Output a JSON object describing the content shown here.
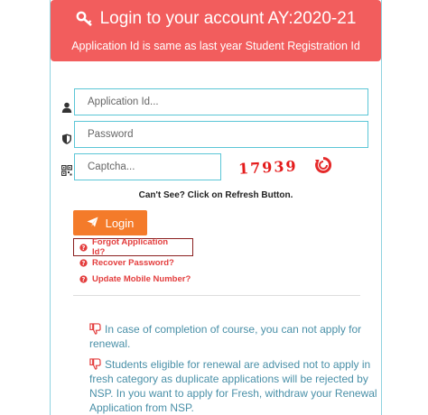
{
  "header": {
    "title": "Login to your account AY:2020-21",
    "subtitle": "Application Id is same as last year Student Registration Id",
    "icon": "key-icon"
  },
  "form": {
    "application_id": {
      "placeholder": "Application Id...",
      "value": "",
      "icon": "user-icon"
    },
    "password": {
      "placeholder": "Password",
      "value": "",
      "icon": "shield-icon"
    },
    "captcha": {
      "placeholder": "Captcha...",
      "value": "",
      "icon": "qrcode-icon"
    },
    "captcha_image_text": "17939",
    "refresh_icon": "refresh-icon",
    "cant_see": "Can't See? Click on Refresh Button.",
    "login_label": "Login",
    "login_icon": "paper-plane-icon"
  },
  "links": [
    {
      "label": "Forgot Application Id?",
      "icon": "question-circle-icon"
    },
    {
      "label": "Recover Password?",
      "icon": "question-circle-icon"
    },
    {
      "label": "Update Mobile Number?",
      "icon": "question-circle-icon"
    }
  ],
  "notices": [
    {
      "text": "In case of completion of course, you can not apply for renewal.",
      "icon": "thumbs-down-icon"
    },
    {
      "text": "Students eligible for renewal are advised not to apply in fresh category as duplicate applications will be rejected by NSP. In you want to apply for Fresh, withdraw your Renewal Application from NSP.",
      "icon": "thumbs-down-icon"
    }
  ],
  "colors": {
    "header_bg": "#f25d5d",
    "input_border": "#5bc6d6",
    "login_button": "#f47b2a",
    "link": "#e33d3d",
    "notice_text": "#4a90a8"
  }
}
